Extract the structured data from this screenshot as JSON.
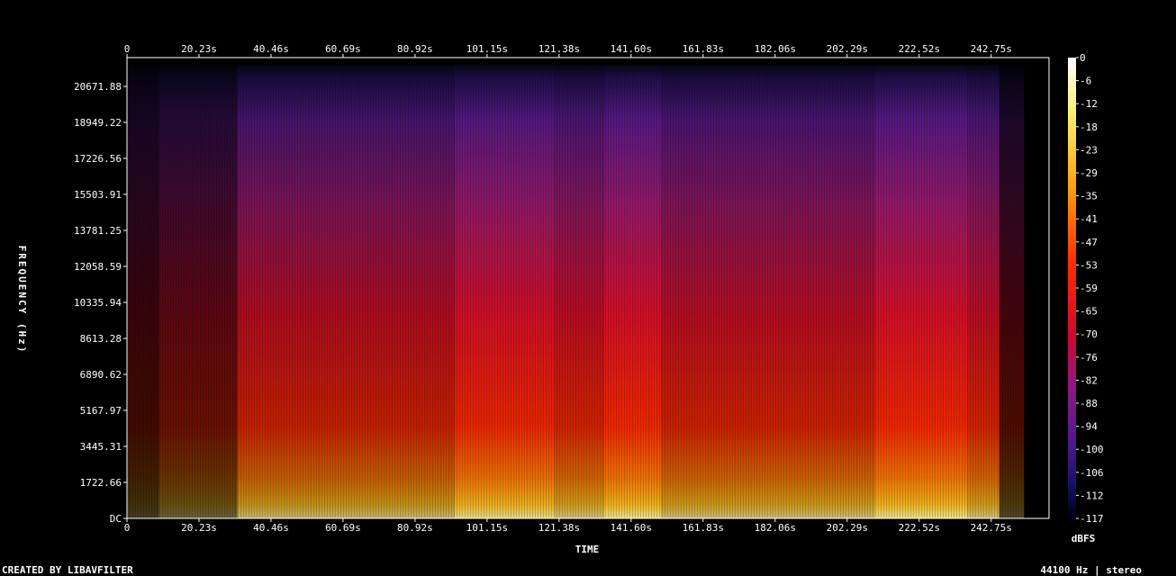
{
  "chart_data": {
    "type": "heatmap",
    "title": "",
    "xlabel": "TIME",
    "ylabel": "FREQUENCY (Hz)",
    "x_ticks": [
      "0",
      "20.23s",
      "40.46s",
      "60.69s",
      "80.92s",
      "101.15s",
      "121.38s",
      "141.60s",
      "161.83s",
      "182.06s",
      "202.29s",
      "222.52s",
      "242.75s"
    ],
    "x_tick_values": [
      0,
      20.23,
      40.46,
      60.69,
      80.92,
      101.15,
      121.38,
      141.6,
      161.83,
      182.06,
      202.29,
      222.52,
      242.75
    ],
    "xlim": [
      0,
      259
    ],
    "y_ticks": [
      "DC",
      "1722.66",
      "3445.31",
      "5167.97",
      "6890.62",
      "8613.28",
      "10335.94",
      "12058.59",
      "13781.25",
      "15503.91",
      "17226.56",
      "18949.22",
      "20671.88"
    ],
    "y_tick_values": [
      0,
      1722.66,
      3445.31,
      5167.97,
      6890.62,
      8613.28,
      10335.94,
      12058.59,
      13781.25,
      15503.91,
      17226.56,
      18949.22,
      20671.88
    ],
    "ylim": [
      0,
      22050
    ],
    "colorbar": {
      "label": "dBFS",
      "ticks": [
        "0",
        "-6",
        "-12",
        "-18",
        "-23",
        "-29",
        "-35",
        "-41",
        "-47",
        "-53",
        "-59",
        "-65",
        "-70",
        "-76",
        "-82",
        "-88",
        "-94",
        "-100",
        "-106",
        "-112",
        "-117"
      ],
      "range": [
        -120,
        0
      ]
    },
    "energy_segments": [
      {
        "t0": 0,
        "t1": 9,
        "level": 0.25
      },
      {
        "t0": 9,
        "t1": 31,
        "level": 0.4
      },
      {
        "t0": 31,
        "t1": 92,
        "level": 0.75
      },
      {
        "t0": 92,
        "t1": 120,
        "level": 0.9
      },
      {
        "t0": 120,
        "t1": 134,
        "level": 0.8
      },
      {
        "t0": 134,
        "t1": 150,
        "level": 0.92
      },
      {
        "t0": 150,
        "t1": 210,
        "level": 0.78
      },
      {
        "t0": 210,
        "t1": 236,
        "level": 0.92
      },
      {
        "t0": 236,
        "t1": 245,
        "level": 0.8
      },
      {
        "t0": 245,
        "t1": 252,
        "level": 0.3
      }
    ]
  },
  "footer": {
    "credit": "CREATED BY LIBAVFILTER",
    "format": "44100 Hz | stereo"
  }
}
